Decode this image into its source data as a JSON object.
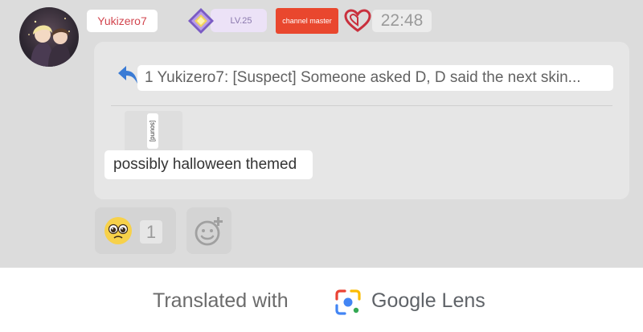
{
  "header": {
    "username": "Yukizero7",
    "level": "LV.25",
    "badge": "channel master",
    "time": "22:48"
  },
  "message": {
    "quote": "1 Yukizero7: [Suspect] Someone asked D, D said the next skin...",
    "sticker_tag": "[sound]",
    "text": "possibly halloween themed"
  },
  "reactions": {
    "count": "1",
    "emoji_icon": "pleading-face-icon",
    "add_icon": "add-reaction-icon"
  },
  "footer": {
    "translated_text": "Translated with",
    "brand": "Google Lens",
    "lens_icon": "google-lens-icon"
  },
  "colors": {
    "chat_background": "#dcdcdc",
    "username": "#d2464f",
    "badge": "#e9472e",
    "heart": "#c9303d",
    "level_badge_bg": "#ece2f7",
    "reply_arrow": "#3a7bd5"
  }
}
